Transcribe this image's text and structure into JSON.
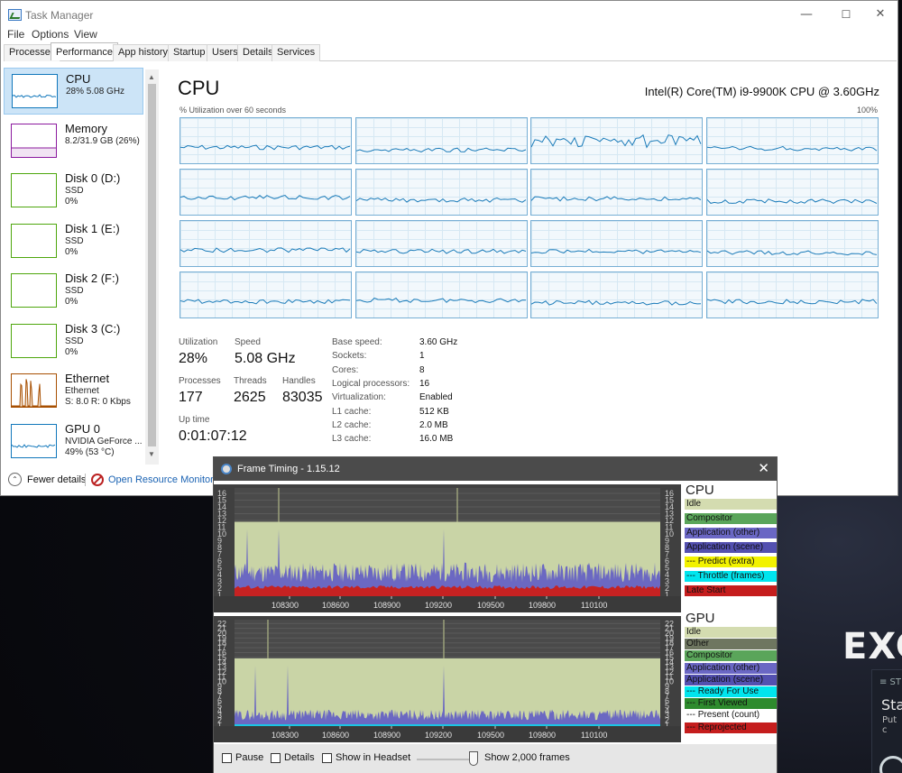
{
  "backdrop": {
    "big_text": "EXC",
    "card_tag": "≡ ST",
    "card_title": "Sta",
    "card_sub": "Put c"
  },
  "taskmanager": {
    "title": "Task Manager",
    "window_buttons": {
      "minimize": "—",
      "maximize": "☐",
      "close": "✕"
    },
    "menu": [
      "File",
      "Options",
      "View"
    ],
    "tabs": [
      "Processes",
      "Performance",
      "App history",
      "Startup",
      "Users",
      "Details",
      "Services"
    ],
    "active_tab": "Performance",
    "resources": [
      {
        "name": "CPU",
        "sub1": "28%  5.08 GHz",
        "sub2": "",
        "sub3": "",
        "color": "#1177bb",
        "selected": true,
        "spark": "flat"
      },
      {
        "name": "Memory",
        "sub1": "8.2/31.9 GB (26%)",
        "sub2": "",
        "sub3": "",
        "color": "#8b1a9e",
        "selected": false,
        "spark": "mem"
      },
      {
        "name": "Disk 0 (D:)",
        "sub1": "SSD",
        "sub2": "0%",
        "sub3": "",
        "color": "#4da60c",
        "selected": false,
        "spark": "none"
      },
      {
        "name": "Disk 1 (E:)",
        "sub1": "SSD",
        "sub2": "0%",
        "sub3": "",
        "color": "#4da60c",
        "selected": false,
        "spark": "none"
      },
      {
        "name": "Disk 2 (F:)",
        "sub1": "SSD",
        "sub2": "0%",
        "sub3": "",
        "color": "#4da60c",
        "selected": false,
        "spark": "none"
      },
      {
        "name": "Disk 3 (C:)",
        "sub1": "SSD",
        "sub2": "0%",
        "sub3": "",
        "color": "#4da60c",
        "selected": false,
        "spark": "none"
      },
      {
        "name": "Ethernet",
        "sub1": "Ethernet",
        "sub2": "S: 8.0  R: 0 Kbps",
        "sub3": "",
        "color": "#a74f01",
        "selected": false,
        "spark": "net"
      },
      {
        "name": "GPU 0",
        "sub1": "NVIDIA GeForce ...",
        "sub2": "49% (53 °C)",
        "sub3": "",
        "color": "#1177bb",
        "selected": false,
        "spark": "gpu"
      }
    ],
    "cpu": {
      "title": "CPU",
      "model": "Intel(R) Core(TM) i9-9900K CPU @ 3.60GHz",
      "util_label": "% Utilization over 60 seconds",
      "util_max": "100%",
      "stats": {
        "utilization_label": "Utilization",
        "utilization": "28%",
        "speed_label": "Speed",
        "speed": "5.08 GHz",
        "processes_label": "Processes",
        "processes": "177",
        "threads_label": "Threads",
        "threads": "2625",
        "handles_label": "Handles",
        "handles": "83035",
        "uptime_label": "Up time",
        "uptime": "0:01:07:12"
      },
      "info": [
        {
          "label": "Base speed:",
          "value": "3.60 GHz"
        },
        {
          "label": "Sockets:",
          "value": "1"
        },
        {
          "label": "Cores:",
          "value": "8"
        },
        {
          "label": "Logical processors:",
          "value": "16"
        },
        {
          "label": "Virtualization:",
          "value": "Enabled"
        },
        {
          "label": "L1 cache:",
          "value": "512 KB"
        },
        {
          "label": "L2 cache:",
          "value": "2.0 MB"
        },
        {
          "label": "L3 cache:",
          "value": "16.0 MB"
        }
      ],
      "core_levels": [
        0.35,
        0.25,
        0.6,
        0.3,
        0.4,
        0.3,
        0.35,
        0.25,
        0.35,
        0.3,
        0.3,
        0.25,
        0.35,
        0.4,
        0.3,
        0.35
      ]
    },
    "footer": {
      "fewer_details": "Fewer details",
      "open_resource_monitor": "Open Resource Monitor"
    }
  },
  "frametiming": {
    "title": "Frame Timing - 1.15.12",
    "close": "✕",
    "cpu": {
      "axis_ticks": [
        "16",
        "15",
        "14",
        "13",
        "12",
        "11",
        "10",
        "9",
        "8",
        "7",
        "6",
        "5",
        "4",
        "3",
        "2",
        "1"
      ],
      "x_ticks": [
        "108300",
        "108600",
        "108900",
        "109200",
        "109500",
        "109800",
        "110100"
      ],
      "legend_title": "CPU",
      "legend": [
        {
          "label": "Idle",
          "bg": "#d4dcb0",
          "fg": "#111"
        },
        {
          "label": "Compositor",
          "bg": "#5aa55a",
          "fg": "#111"
        },
        {
          "label": "Application (other)",
          "bg": "#6a67c4",
          "fg": "#111"
        },
        {
          "label": "Application (scene)",
          "bg": "#5350b0",
          "fg": "#111"
        },
        {
          "label": "--- Predict (extra)",
          "bg": "#f2f200",
          "fg": "#111"
        },
        {
          "label": "--- Throttle (frames)",
          "bg": "#00e5ee",
          "fg": "#111"
        },
        {
          "label": "Late Start",
          "bg": "#c51d1d",
          "fg": "#111"
        }
      ]
    },
    "gpu": {
      "axis_ticks": [
        "22",
        "21",
        "20",
        "19",
        "18",
        "17",
        "16",
        "15",
        "14",
        "13",
        "12",
        "11",
        "10",
        "9",
        "8",
        "7",
        "6",
        "5",
        "4",
        "3",
        "2",
        "1"
      ],
      "x_ticks": [
        "108300",
        "108600",
        "108900",
        "109200",
        "109500",
        "109800",
        "110100"
      ],
      "legend_title": "GPU",
      "legend": [
        {
          "label": "Idle",
          "bg": "#d4dcb0",
          "fg": "#111"
        },
        {
          "label": "Other",
          "bg": "#6e7660",
          "fg": "#111"
        },
        {
          "label": "Compositor",
          "bg": "#5aa55a",
          "fg": "#111"
        },
        {
          "label": "Application (other)",
          "bg": "#6a67c4",
          "fg": "#111"
        },
        {
          "label": "Application (scene)",
          "bg": "#5350b0",
          "fg": "#111"
        },
        {
          "label": "--- Ready For Use",
          "bg": "#00e5ee",
          "fg": "#111"
        },
        {
          "label": "--- First Viewed",
          "bg": "#2e8b2e",
          "fg": "#111"
        },
        {
          "label": "--- Present (count)",
          "bg": "#ffffff",
          "fg": "#111"
        },
        {
          "label": "--- Reprojected",
          "bg": "#c51d1d",
          "fg": "#111"
        }
      ]
    },
    "controls": {
      "pause": "Pause",
      "details": "Details",
      "show_in_headset": "Show in Headset",
      "frames": "Show 2,000 frames"
    }
  }
}
